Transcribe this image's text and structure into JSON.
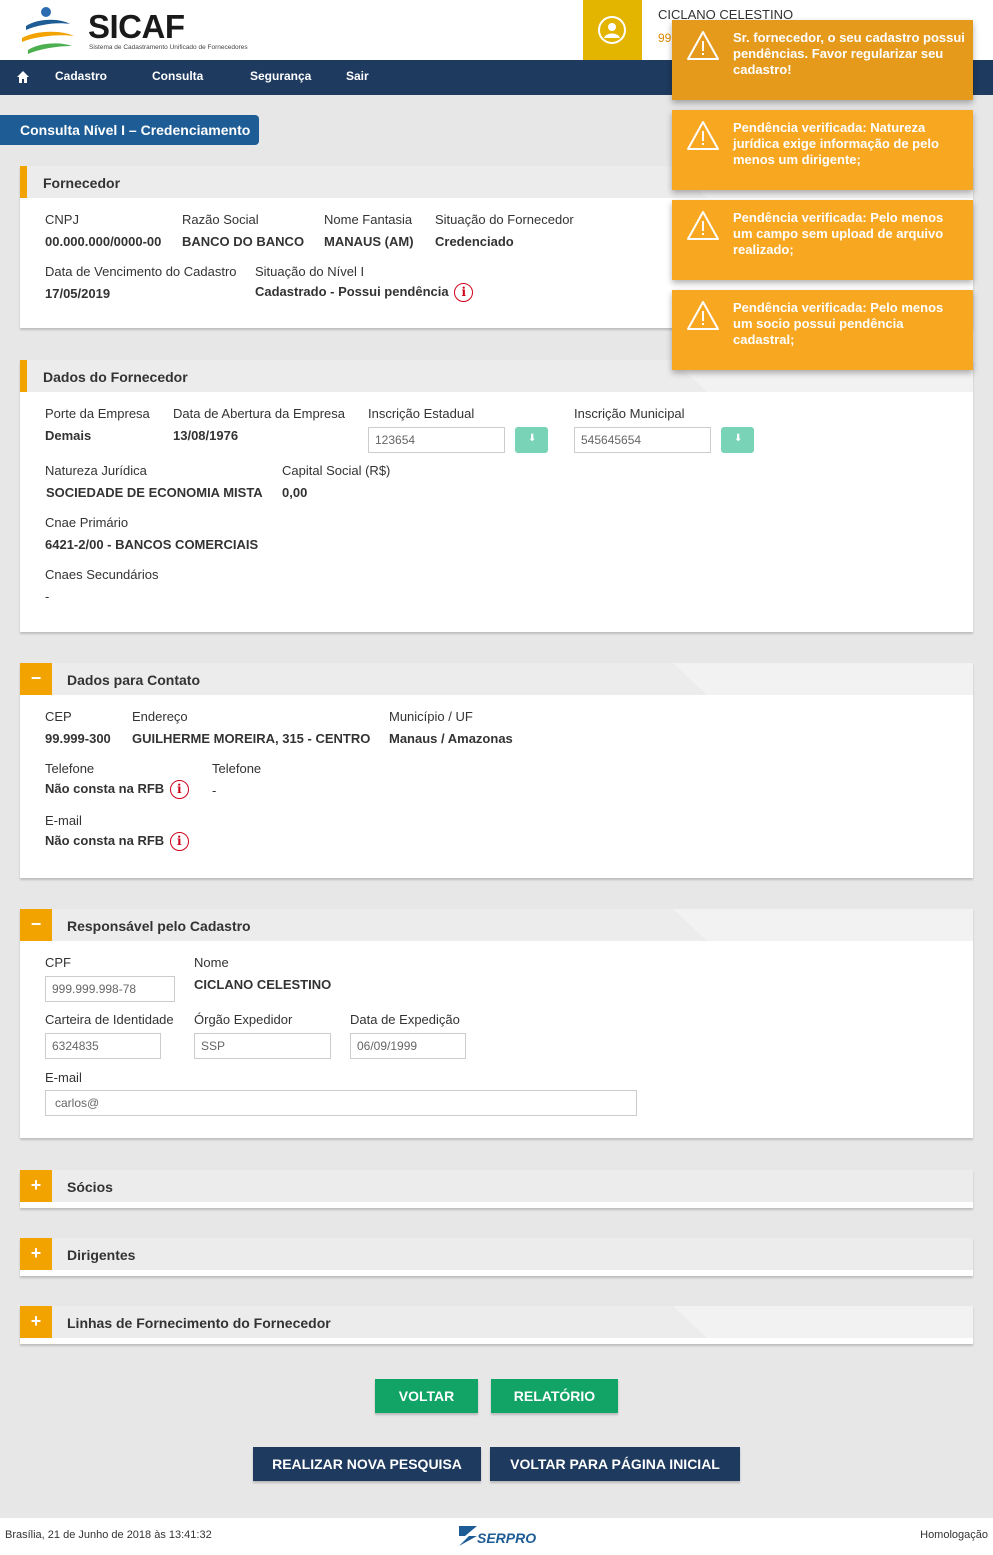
{
  "header": {
    "logo_title": "SICAF",
    "logo_subtitle": "Sistema de Cadastramento Unificado de Fornecedores",
    "user_name": "CICLANO CELESTINO",
    "user_cpf": "999.999.998-78"
  },
  "nav": {
    "items": [
      "Cadastro",
      "Consulta",
      "Segurança",
      "Sair"
    ]
  },
  "page_title": "Consulta Nível I – Credenciamento",
  "notifications": [
    "Sr. fornecedor, o seu cadastro possui pendências. Favor regularizar seu cadastro!",
    "Pendência verificada: Natureza jurídica exige informação de pelo menos um dirigente;",
    "Pendência verificada: Pelo menos um campo sem upload de arquivo realizado;",
    "Pendência verificada: Pelo menos um socio possui pendência cadastral;"
  ],
  "fornecedor": {
    "title": "Fornecedor",
    "cnpj_label": "CNPJ",
    "cnpj": "00.000.000/0000-00",
    "razao_label": "Razão Social",
    "razao": "BANCO DO BANCO",
    "fantasia_label": "Nome Fantasia",
    "fantasia": "MANAUS (AM)",
    "situacao_label": "Situação do Fornecedor",
    "situacao": "Credenciado",
    "vencimento_label": "Data de Vencimento do Cadastro",
    "vencimento": "17/05/2019",
    "nivel_label": "Situação do Nível I",
    "nivel": "Cadastrado - Possui pendência"
  },
  "dados": {
    "title": "Dados do Fornecedor",
    "porte_label": "Porte da Empresa",
    "porte": "Demais",
    "abertura_label": "Data de Abertura da Empresa",
    "abertura": "13/08/1976",
    "ie_label": "Inscrição Estadual",
    "ie": "123654",
    "im_label": "Inscrição Municipal",
    "im": "545645654",
    "natureza_label": "Natureza Jurídica",
    "natureza": "SOCIEDADE DE ECONOMIA MISTA",
    "capital_label": "Capital Social (R$)",
    "capital": "0,00",
    "cnae_label": "Cnae Primário",
    "cnae": "6421-2/00 - BANCOS COMERCIAIS",
    "cnaes_sec_label": "Cnaes Secundários",
    "cnaes_sec": "-"
  },
  "contato": {
    "title": "Dados para Contato",
    "toggle": "−",
    "cep_label": "CEP",
    "cep": "99.999-300",
    "endereco_label": "Endereço",
    "endereco": "GUILHERME MOREIRA, 315 - CENTRO",
    "municipio_label": "Município / UF",
    "municipio": "Manaus / Amazonas",
    "telefone1_label": "Telefone",
    "telefone1": "Não consta na RFB",
    "telefone2_label": "Telefone",
    "telefone2": "-",
    "email_label": "E-mail",
    "email": "Não consta na RFB"
  },
  "responsavel": {
    "title": "Responsável pelo Cadastro",
    "toggle": "−",
    "cpf_label": "CPF",
    "cpf": "999.999.998-78",
    "nome_label": "Nome",
    "nome": "CICLANO CELESTINO",
    "identidade_label": "Carteira de Identidade",
    "identidade": "6324835",
    "orgao_label": "Órgão Expedidor",
    "orgao": "SSP",
    "expedicao_label": "Data de Expedição",
    "expedicao": "06/09/1999",
    "email_label": "E-mail",
    "email": "carlos@"
  },
  "collapsed": [
    {
      "title": "Sócios",
      "toggle": "+"
    },
    {
      "title": "Dirigentes",
      "toggle": "+"
    },
    {
      "title": "Linhas de Fornecimento do Fornecedor",
      "toggle": "+"
    }
  ],
  "info_glyph": "i",
  "buttons": {
    "voltar": "VOLTAR",
    "relatorio": "RELATÓRIO",
    "nova_pesquisa": "REALIZAR NOVA PESQUISA",
    "pagina_inicial": "VOLTAR PARA PÁGINA INICIAL"
  },
  "footer": {
    "date": "Brasília, 21 de Junho de 2018 às 13:41:32",
    "brand": "SERPRO",
    "env": "Homologação"
  },
  "colors": {
    "nav": "#1e3a5f",
    "accent": "#f3a300",
    "toast": "#f8a721",
    "green": "#12a466",
    "alert": "#d0021b"
  }
}
